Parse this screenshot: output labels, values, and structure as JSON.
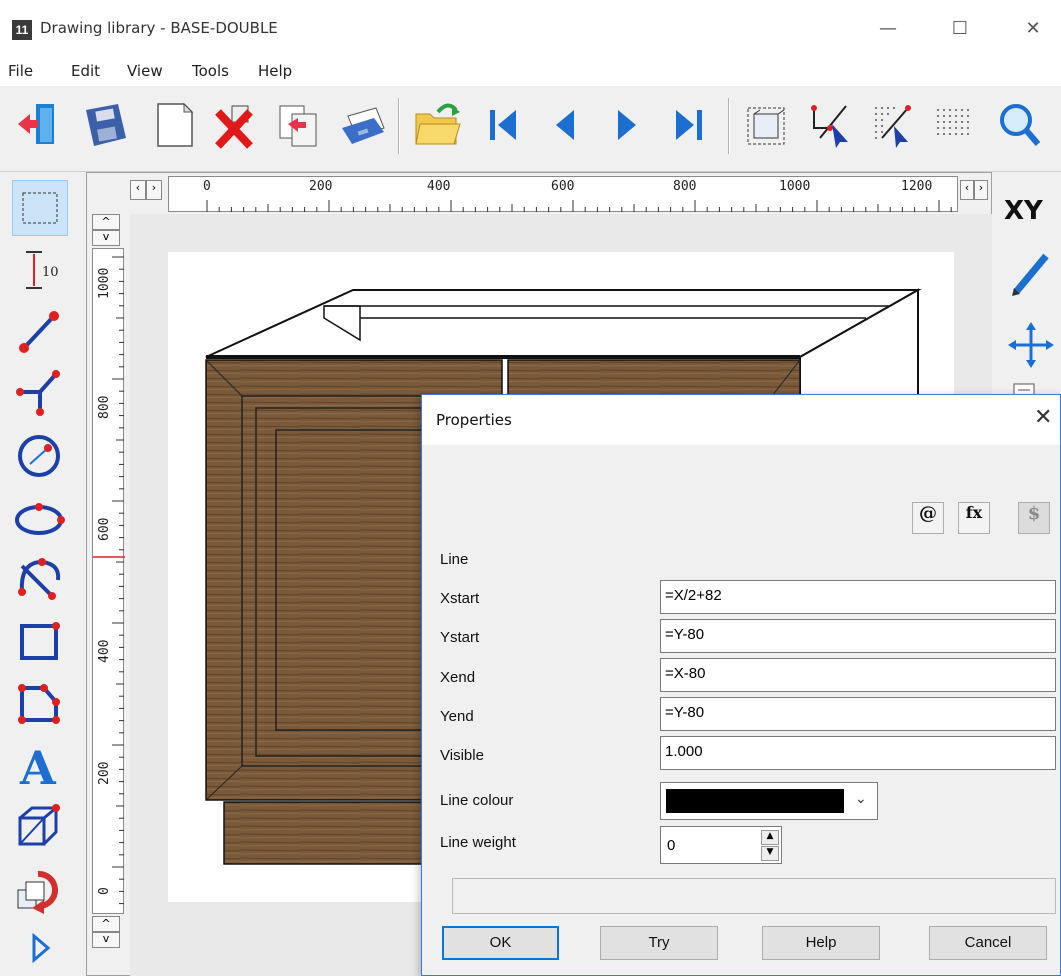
{
  "window": {
    "app_icon_label": "11",
    "title": "Drawing library - BASE-DOUBLE",
    "minimize": "—",
    "maximize": "☐",
    "close": "✕"
  },
  "menu": [
    "File",
    "Edit",
    "View",
    "Tools",
    "Help"
  ],
  "toolbar": {
    "buttons": [
      "exit-icon",
      "save-icon",
      "new-page-icon",
      "delete-icon",
      "copy-icon",
      "print-icon",
      "open-folder-icon",
      "first-icon",
      "previous-icon",
      "next-icon",
      "last-icon",
      "bounding-box-icon",
      "select-arrow-icon",
      "snap-grid-icon",
      "grid-icon",
      "zoom-icon"
    ]
  },
  "ruler": {
    "horizontal": [
      "0",
      "200",
      "400",
      "600",
      "800",
      "1000",
      "1200"
    ],
    "vertical": [
      "1000",
      "800",
      "600",
      "400",
      "200",
      "0"
    ],
    "scroll_left": "‹",
    "scroll_right": "›",
    "scroll_up": "^",
    "scroll_down": "v"
  },
  "right_tools": {
    "xy_label": "XY"
  },
  "dialog": {
    "title": "Properties",
    "close": "✕",
    "icon_at": "@",
    "icon_fx": "fx",
    "icon_dollar": "$",
    "section": "Line",
    "fields": [
      {
        "label": "Xstart",
        "value": "=X/2+82"
      },
      {
        "label": "Ystart",
        "value": "=Y-80"
      },
      {
        "label": "Xend",
        "value": "=X-80"
      },
      {
        "label": "Yend",
        "value": "=Y-80"
      },
      {
        "label": "Visible",
        "value": "1.000"
      }
    ],
    "line_colour_label": "Line colour",
    "line_colour_value": "#000000",
    "line_weight_label": "Line weight",
    "line_weight_value": "0",
    "buttons": {
      "ok": "OK",
      "try": "Try",
      "help": "Help",
      "cancel": "Cancel"
    }
  },
  "colors": {
    "accent": "#0078d7",
    "wood": "#7a5a3a",
    "wood_dark": "#5e4328",
    "canvas": "#e9e9e9",
    "red_marker": "#e02020"
  }
}
